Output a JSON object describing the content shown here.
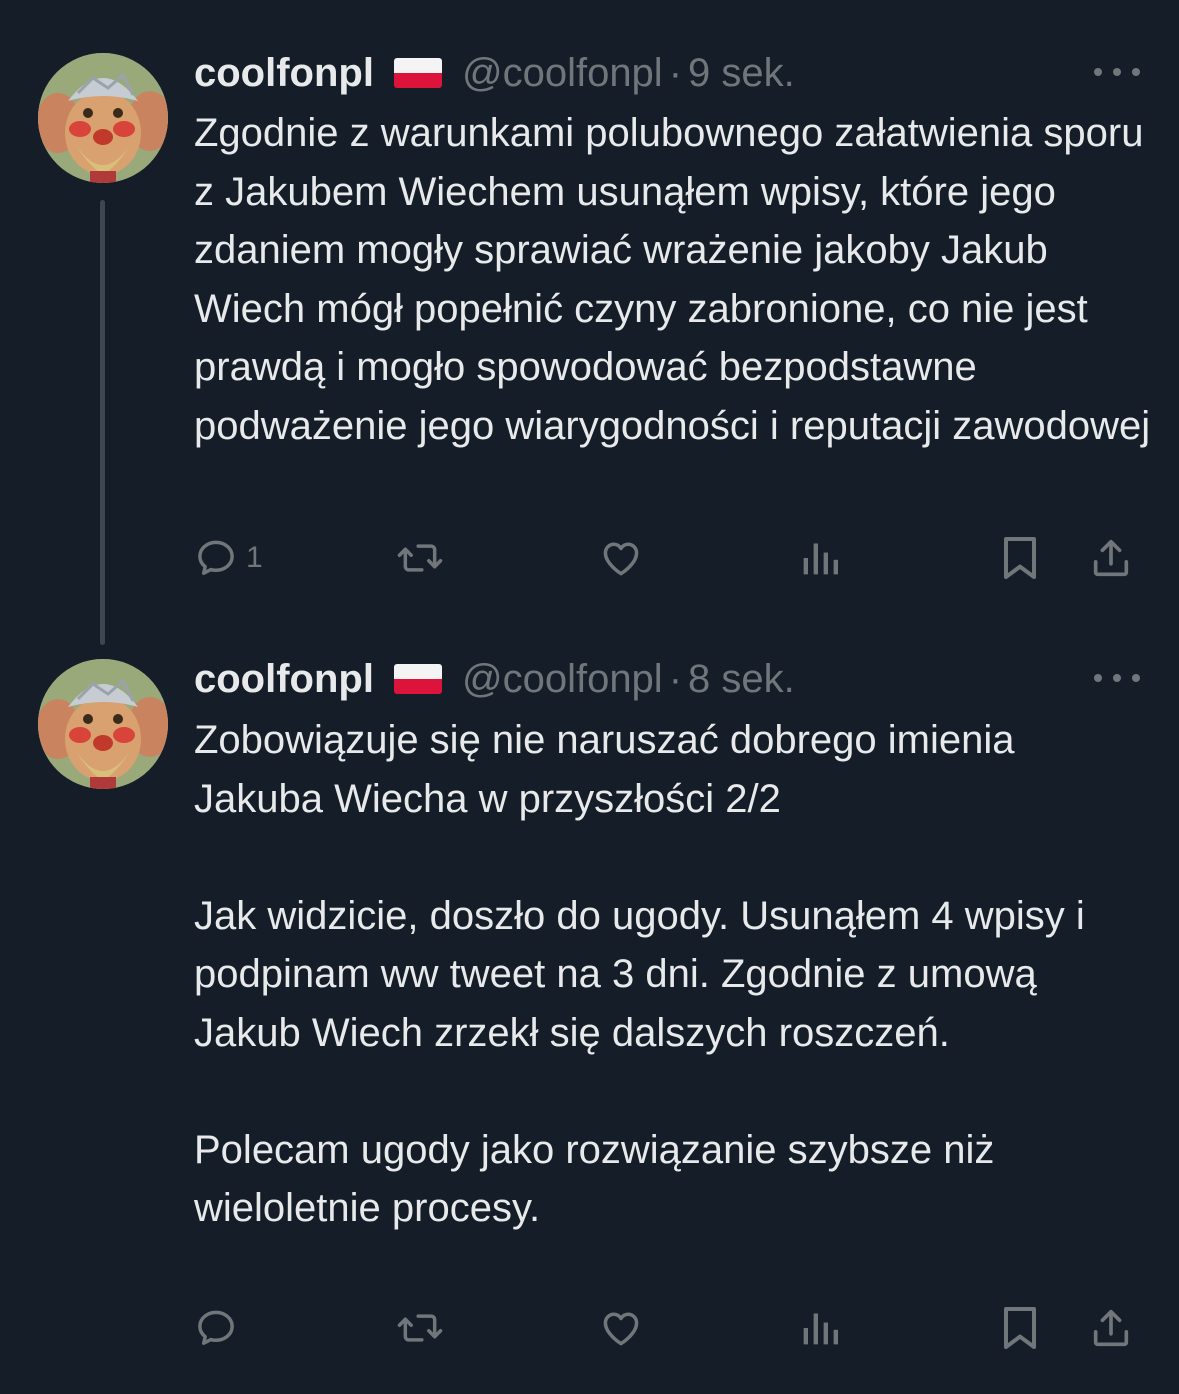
{
  "tweets": [
    {
      "name": "coolfonpl",
      "flag": "Poland flag emoji",
      "handle": "@coolfonpl",
      "separator": "·",
      "time": "9 sek.",
      "paragraphs": [
        "Zgodnie z warunkami polubownego załatwienia sporu z Jakubem Wiechem usunąłem wpisy, które jego zdaniem mogły sprawiać wrażenie jakoby Jakub Wiech mógł popełnić czyny zabronione, co nie jest prawdą i mogło spowodować bezpodstawne podważenie jego wiarygodności i reputacji zawodowej"
      ],
      "reply_count": "1",
      "icons": [
        "reply-icon",
        "retweet-icon",
        "like-icon",
        "views-icon",
        "bookmark-icon",
        "share-icon"
      ]
    },
    {
      "name": "coolfonpl",
      "flag": "Poland flag emoji",
      "handle": "@coolfonpl",
      "separator": "·",
      "time": "8 sek.",
      "paragraphs": [
        "Zobowiązuje się nie naruszać dobrego imienia Jakuba Wiecha w przyszłości 2/2",
        "Jak widzicie, doszło do ugody. Usunąłem 4 wpisy i podpinam ww tweet na 3 dni. Zgodnie z umową Jakub Wiech zrzekł się dalszych roszczeń.",
        "Polecam ugody jako rozwiązanie szybsze niż wieloletnie procesy."
      ],
      "reply_count": "",
      "icons": [
        "reply-icon",
        "retweet-icon",
        "like-icon",
        "views-icon",
        "bookmark-icon",
        "share-icon"
      ]
    }
  ],
  "colors": {
    "background": "#151d28",
    "text": "#e7e9ea",
    "muted": "#71767b",
    "thread_line": "#3e4650",
    "flag_red": "#dc143c",
    "flag_white": "#f4f4f4"
  }
}
